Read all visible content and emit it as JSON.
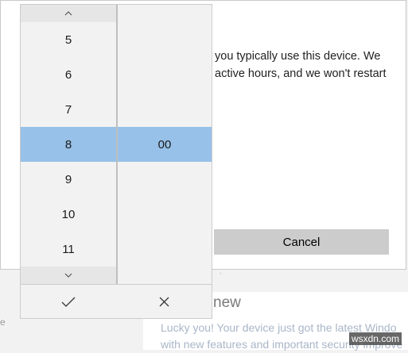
{
  "background": {
    "description_lines": [
      "you typically use this device. We",
      "active hours, and we won't restart"
    ],
    "cancel_label": "Cancel",
    "section_heading": "new",
    "update_lines": [
      "Lucky you! Your device just got the latest Windo",
      "with new features and important security improve"
    ],
    "side_fragment": "e"
  },
  "watermark": "wsxdn.com",
  "picker": {
    "hours": [
      "5",
      "6",
      "7",
      "8",
      "9",
      "10",
      "11"
    ],
    "selected_hour": "8",
    "minute_value": "00",
    "scroll_up_icon": "chevron-up-icon",
    "scroll_down_icon": "chevron-down-icon",
    "accept_icon": "checkmark-icon",
    "dismiss_icon": "close-icon"
  },
  "colors": {
    "selection": "#97c1e8",
    "picker_bg": "#f2f2f2",
    "button_bg": "#cccccc"
  }
}
